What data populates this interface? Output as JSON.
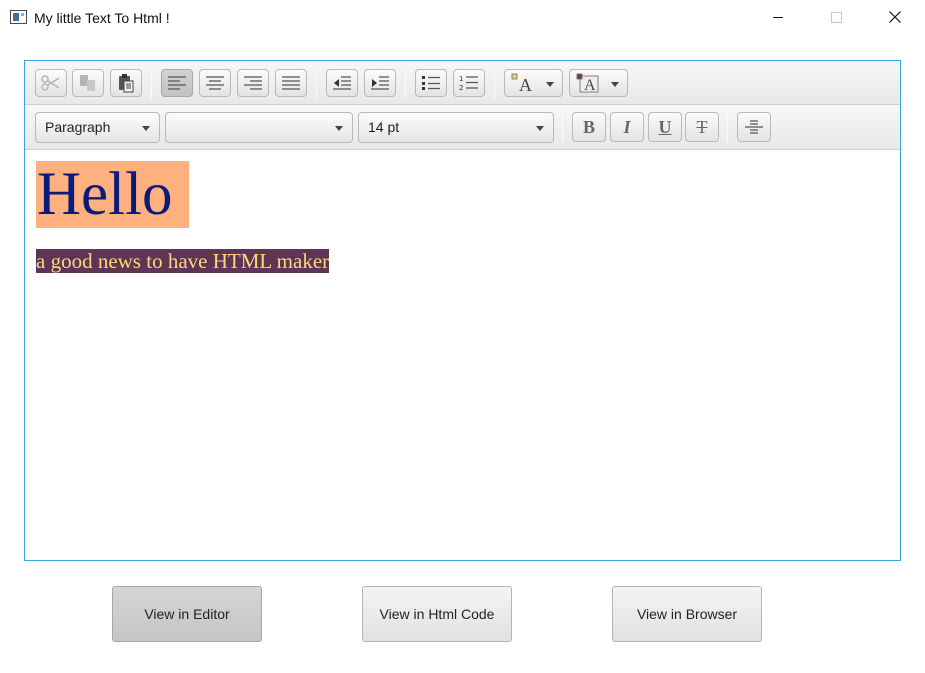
{
  "window": {
    "title": "My little Text To Html !",
    "controls": [
      "minimize-icon",
      "maximize-icon",
      "close-icon"
    ]
  },
  "toolbar1": {
    "buttons": [
      {
        "icon": "cut-icon",
        "enabled": false
      },
      {
        "icon": "copy-icon",
        "enabled": false
      },
      {
        "icon": "paste-icon",
        "enabled": true
      },
      {
        "icon": "align-left-icon",
        "pressed": true
      },
      {
        "icon": "align-center-icon"
      },
      {
        "icon": "align-right-icon"
      },
      {
        "icon": "align-justify-icon"
      },
      {
        "icon": "outdent-icon"
      },
      {
        "icon": "indent-icon"
      },
      {
        "icon": "bullet-list-icon"
      },
      {
        "icon": "numbered-list-icon"
      },
      {
        "icon": "text-color-icon",
        "dropdown": true
      },
      {
        "icon": "background-color-icon",
        "dropdown": true
      }
    ]
  },
  "toolbar2": {
    "format_select": "Paragraph",
    "font_family_select": "",
    "font_size_select": "14 pt",
    "format_buttons": {
      "bold": "B",
      "italic": "I",
      "underline": "U",
      "strikethrough": "T"
    },
    "horizontal_rule_icon": "horizontal-rule-icon"
  },
  "content": {
    "heading": "Hello",
    "heading_colors": {
      "text": "#0c1a7a",
      "background": "#ffb07f"
    },
    "subline": "a good news to have HTML maker",
    "subline_colors": {
      "text": "#ffd77a",
      "background": "#5c3557"
    }
  },
  "buttons": {
    "view_editor": "View in Editor",
    "view_html_code": "View in Html Code",
    "view_browser": "View in Browser"
  },
  "colors": {
    "editor_border": "#34a7dc"
  }
}
